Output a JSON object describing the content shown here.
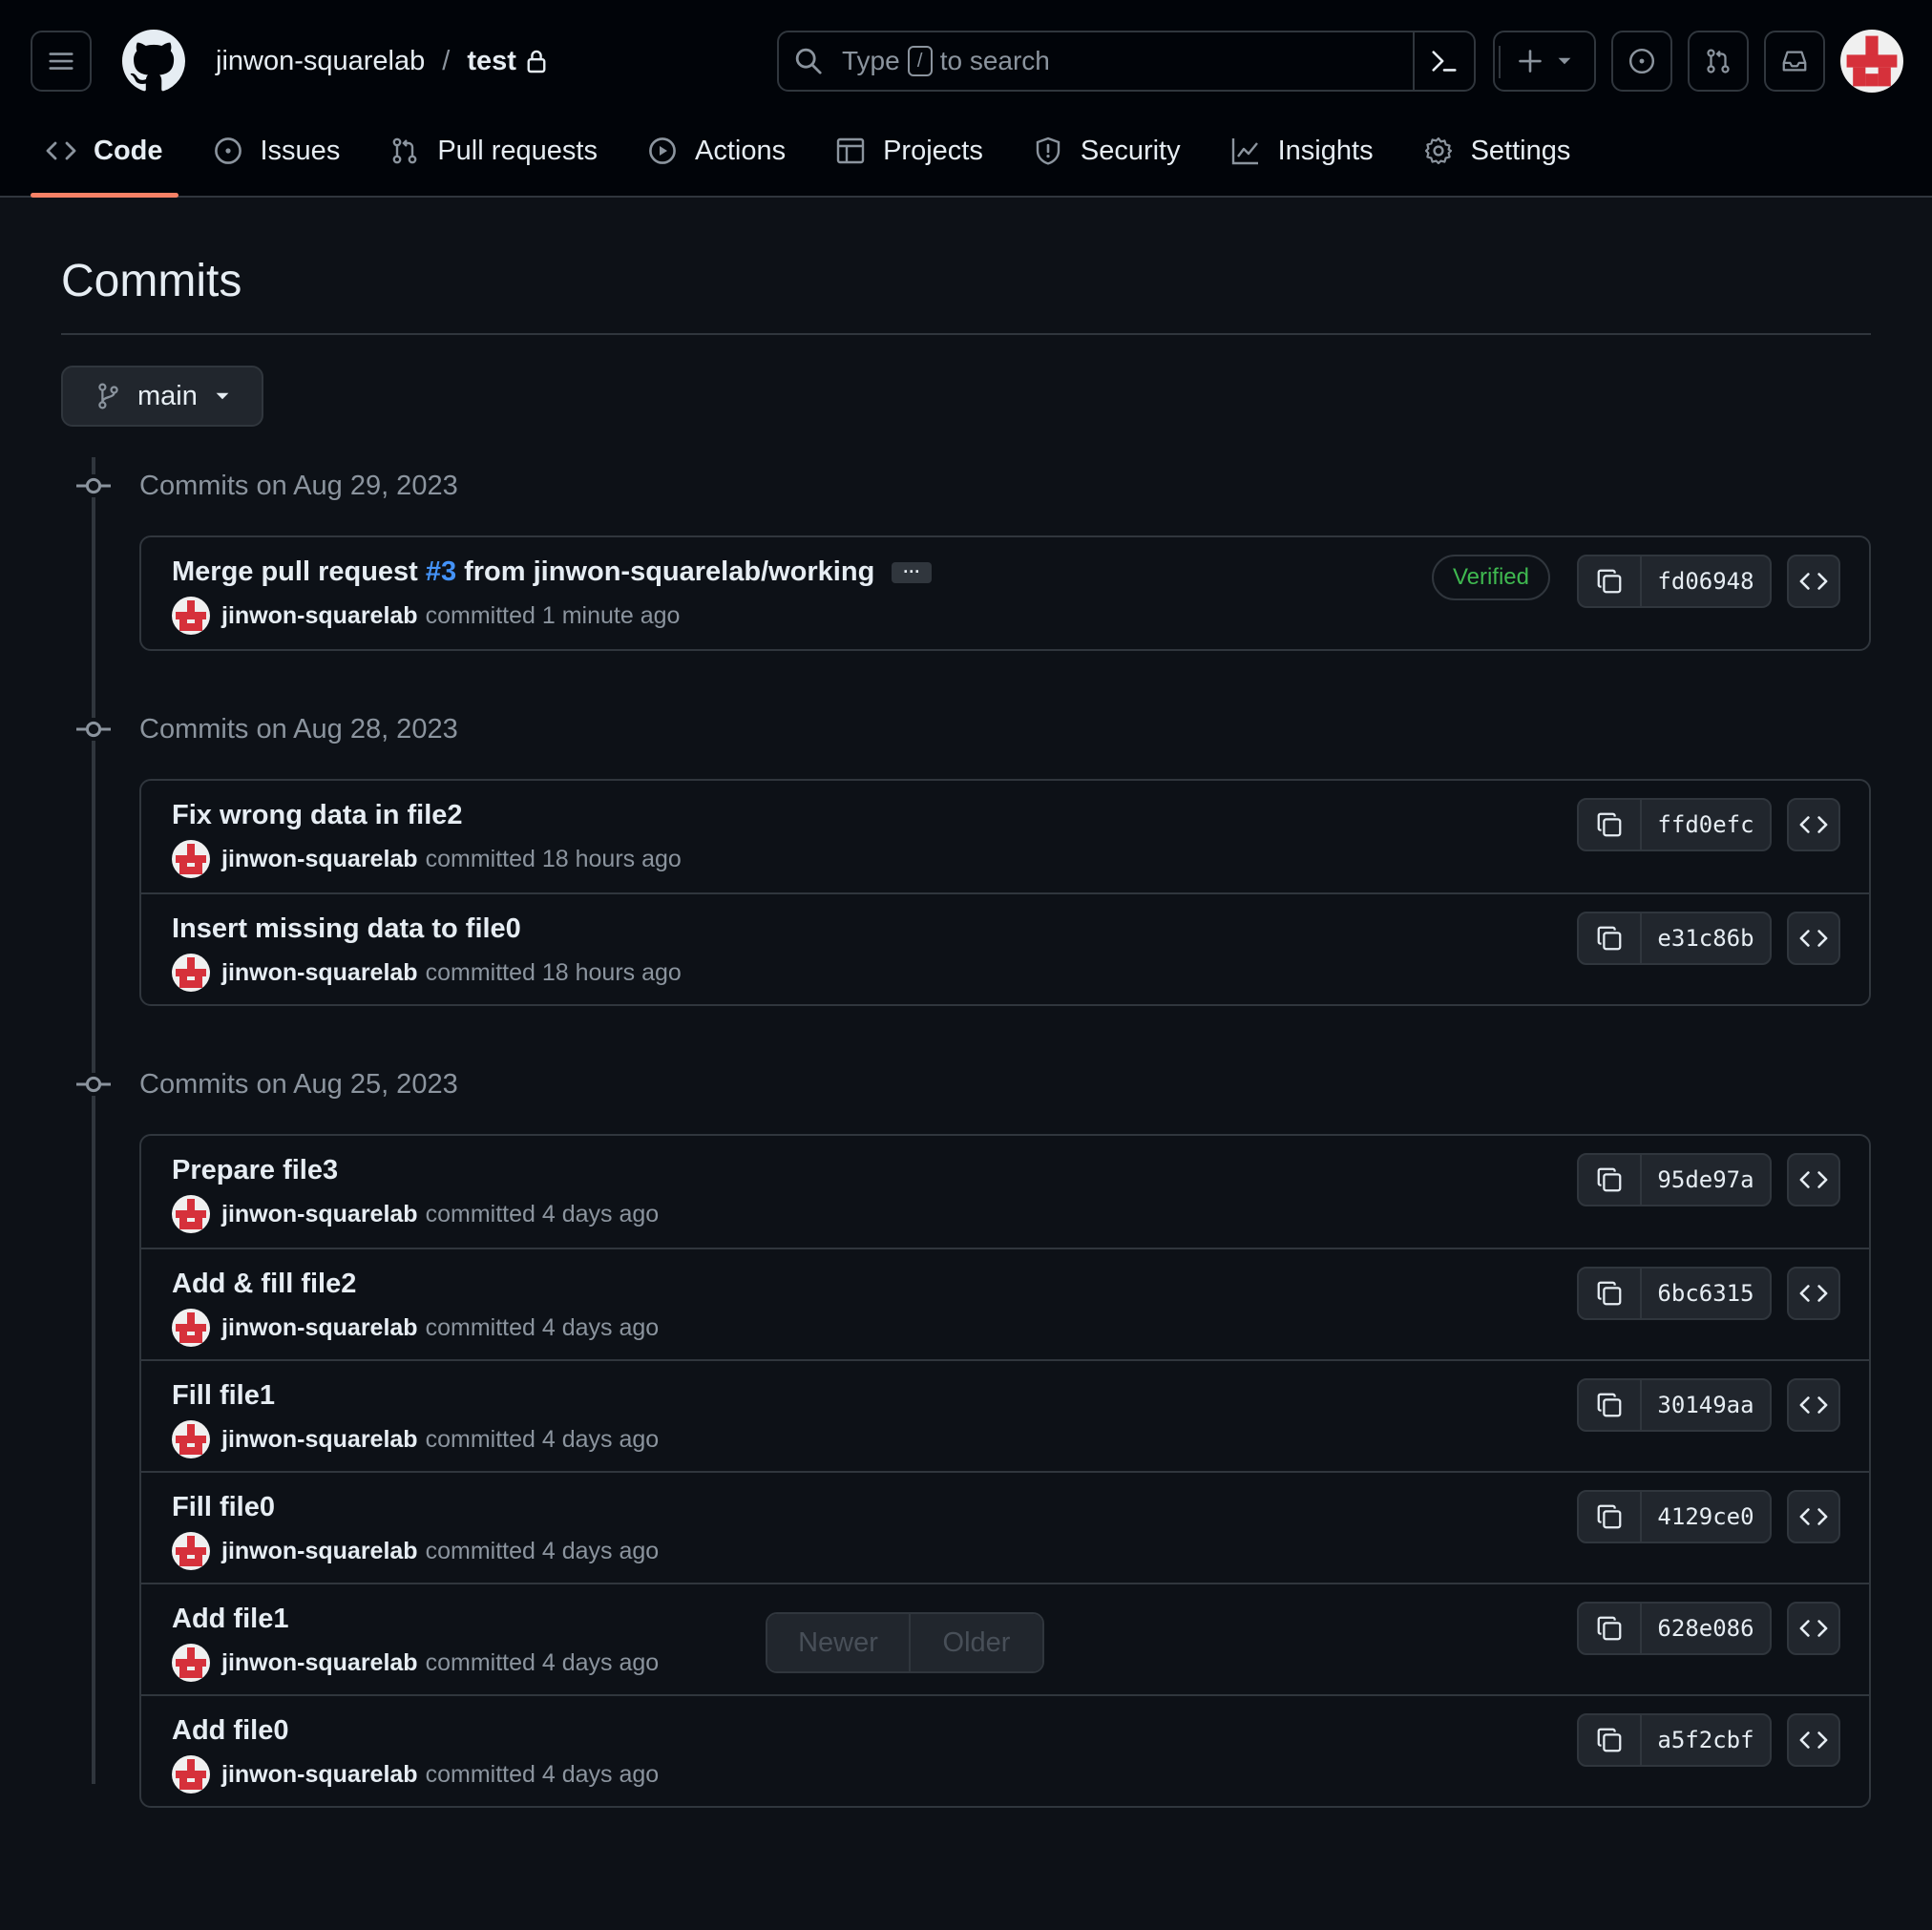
{
  "header": {
    "owner": "jinwon-squarelab",
    "separator": "/",
    "repo": "test",
    "search": {
      "prefix": "Type",
      "key": "/",
      "suffix": "to search"
    }
  },
  "tabs": [
    {
      "label": "Code",
      "icon": "code-icon"
    },
    {
      "label": "Issues",
      "icon": "issue-icon"
    },
    {
      "label": "Pull requests",
      "icon": "pull-request-icon"
    },
    {
      "label": "Actions",
      "icon": "play-icon"
    },
    {
      "label": "Projects",
      "icon": "table-icon"
    },
    {
      "label": "Security",
      "icon": "shield-icon"
    },
    {
      "label": "Insights",
      "icon": "graph-icon"
    },
    {
      "label": "Settings",
      "icon": "gear-icon"
    }
  ],
  "page": {
    "title": "Commits",
    "branch": "main"
  },
  "groups": [
    {
      "date_label": "Commits on Aug 29, 2023",
      "commits": [
        {
          "message_pre": "Merge pull request",
          "pr": "#3",
          "message_post": "from jinwon-squarelab/working",
          "ellipsis": "···",
          "author": "jinwon-squarelab",
          "verb": "committed",
          "when": "1 minute ago",
          "badge": "Verified",
          "sha": "fd06948"
        }
      ]
    },
    {
      "date_label": "Commits on Aug 28, 2023",
      "commits": [
        {
          "message": "Fix wrong data in file2",
          "author": "jinwon-squarelab",
          "verb": "committed",
          "when": "18 hours ago",
          "sha": "ffd0efc"
        },
        {
          "message": "Insert missing data to file0",
          "author": "jinwon-squarelab",
          "verb": "committed",
          "when": "18 hours ago",
          "sha": "e31c86b"
        }
      ]
    },
    {
      "date_label": "Commits on Aug 25, 2023",
      "commits": [
        {
          "message": "Prepare file3",
          "author": "jinwon-squarelab",
          "verb": "committed",
          "when": "4 days ago",
          "sha": "95de97a"
        },
        {
          "message": "Add & fill file2",
          "author": "jinwon-squarelab",
          "verb": "committed",
          "when": "4 days ago",
          "sha": "6bc6315"
        },
        {
          "message": "Fill file1",
          "author": "jinwon-squarelab",
          "verb": "committed",
          "when": "4 days ago",
          "sha": "30149aa"
        },
        {
          "message": "Fill file0",
          "author": "jinwon-squarelab",
          "verb": "committed",
          "when": "4 days ago",
          "sha": "4129ce0"
        },
        {
          "message": "Add file1",
          "author": "jinwon-squarelab",
          "verb": "committed",
          "when": "4 days ago",
          "sha": "628e086"
        },
        {
          "message": "Add file0",
          "author": "jinwon-squarelab",
          "verb": "committed",
          "when": "4 days ago",
          "sha": "a5f2cbf"
        }
      ]
    }
  ],
  "pagination": {
    "newer": "Newer",
    "older": "Older"
  },
  "colors": {
    "accent": "#f78166",
    "link": "#4493f8",
    "verified": "#3fb950",
    "background": "#0d1117",
    "header": "#010409"
  }
}
